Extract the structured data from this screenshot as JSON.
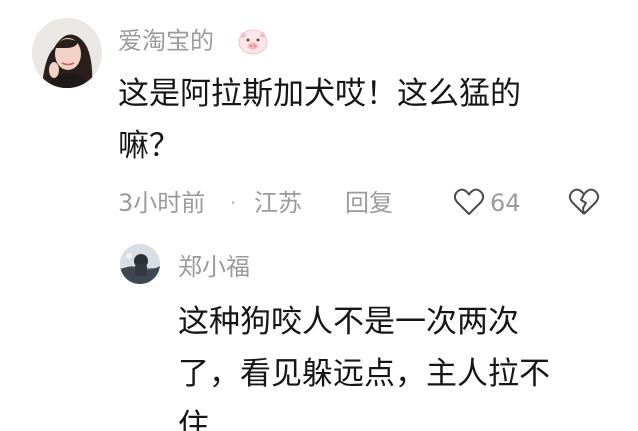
{
  "comment": {
    "username": "爱淘宝的",
    "badge_icon": "pig-emoji-icon",
    "text_lines": [
      "这是阿拉斯加犬哎！这么猛的",
      "嘛？"
    ],
    "time": "3小时前",
    "separator": "·",
    "location": "江苏",
    "reply_label": "回复",
    "likes": "64",
    "like_icon": "heart-outline-icon",
    "dislike_icon": "broken-heart-icon"
  },
  "reply": {
    "username": "郑小福",
    "text_lines": [
      "这种狗咬人不是一次两次",
      "了，看见躲远点，主人拉不",
      "住"
    ]
  },
  "colors": {
    "meta_text": "#9b9b9b",
    "body_text": "#161616",
    "icon_stroke": "#4a4a4a"
  }
}
